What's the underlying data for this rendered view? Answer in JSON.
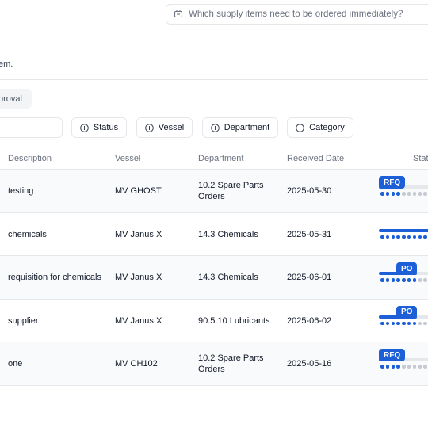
{
  "search": {
    "placeholder": "Which supply items need to be ordered immediately?"
  },
  "subtitle": "em.",
  "chip": {
    "label": "proval"
  },
  "filters": [
    "Status",
    "Vessel",
    "Department",
    "Category"
  ],
  "table": {
    "headers": [
      "Description",
      "Vessel",
      "Department",
      "Received Date",
      "Stat"
    ],
    "rows": [
      {
        "description": "testing",
        "vessel": "MV GHOST",
        "department": "10.2 Spare Parts Orders",
        "date": "2025-05-30",
        "badge": "RFQ",
        "progress": 0.3,
        "steps_done": 4,
        "steps_total": 11
      },
      {
        "description": "chemicals",
        "vessel": "MV Janus X",
        "department": "14.3 Chemicals",
        "date": "2025-05-31",
        "badge": "",
        "progress": 1.0,
        "steps_done": 11,
        "steps_total": 11
      },
      {
        "description": "requisition for chemicals",
        "vessel": "MV Janus X",
        "department": "14.3 Chemicals",
        "date": "2025-06-01",
        "badge": "PO",
        "progress": 0.6,
        "steps_done": 7,
        "steps_total": 11
      },
      {
        "description": "supplier",
        "vessel": "MV Janus X",
        "department": "90.5.10 Lubricants",
        "date": "2025-06-02",
        "badge": "PO",
        "progress": 0.6,
        "steps_done": 7,
        "steps_total": 11
      },
      {
        "description": "one",
        "vessel": "MV CH102",
        "department": "10.2 Spare Parts Orders",
        "date": "2025-05-16",
        "badge": "RFQ",
        "progress": 0.3,
        "steps_done": 4,
        "steps_total": 11
      }
    ]
  },
  "colors": {
    "accent": "#1d5fd6",
    "dot_off": "#c4c9d2",
    "border": "#e5e7eb"
  }
}
